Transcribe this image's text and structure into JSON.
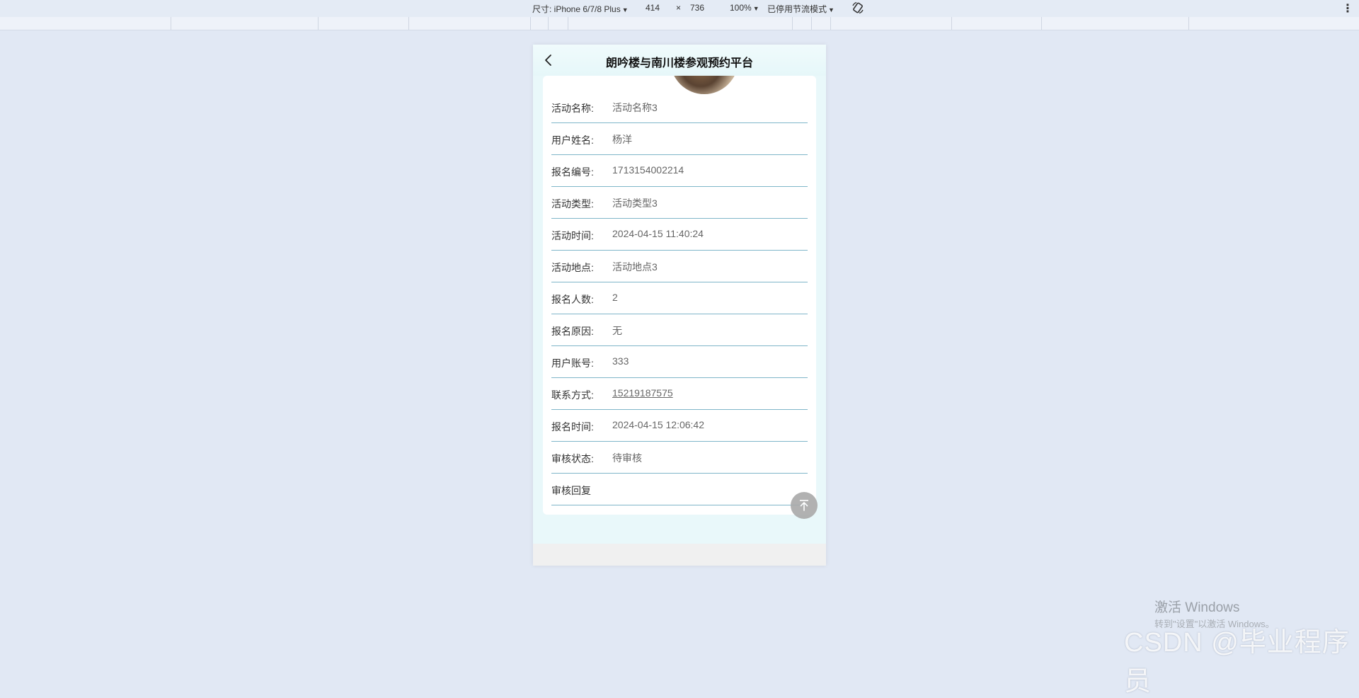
{
  "devtools": {
    "dimensions_label": "尺寸: iPhone 6/7/8 Plus",
    "width": "414",
    "times": "×",
    "height": "736",
    "zoom": "100%",
    "throttle": "已停用节流模式"
  },
  "app": {
    "title": "朗吟楼与南川楼参观预约平台",
    "fields": [
      {
        "label": "活动名称:",
        "value": "活动名称3"
      },
      {
        "label": "用户姓名:",
        "value": "杨洋"
      },
      {
        "label": "报名编号:",
        "value": "1713154002214"
      },
      {
        "label": "活动类型:",
        "value": "活动类型3"
      },
      {
        "label": "活动时间:",
        "value": "2024-04-15 11:40:24"
      },
      {
        "label": "活动地点:",
        "value": "活动地点3"
      },
      {
        "label": "报名人数:",
        "value": "2"
      },
      {
        "label": "报名原因:",
        "value": "无"
      },
      {
        "label": "用户账号:",
        "value": "333"
      },
      {
        "label": "联系方式:",
        "value": "15219187575"
      },
      {
        "label": "报名时间:",
        "value": "2024-04-15 12:06:42"
      },
      {
        "label": "审核状态:",
        "value": "待审核"
      },
      {
        "label": "审核回复",
        "value": ""
      }
    ]
  },
  "watermarks": {
    "windows_activate": "激活 Windows",
    "windows_activate_sub": "转到\"设置\"以激活 Windows。",
    "csdn": "CSDN @毕业程序员"
  },
  "colors": {
    "page_bg": "#e1e8f4",
    "phone_bg": "#e9f8fa",
    "row_divider": "#7fb6c9"
  },
  "icons": [
    "back-chevron-icon",
    "rotate-icon",
    "back-to-top-icon",
    "kebab-menu-icon"
  ]
}
